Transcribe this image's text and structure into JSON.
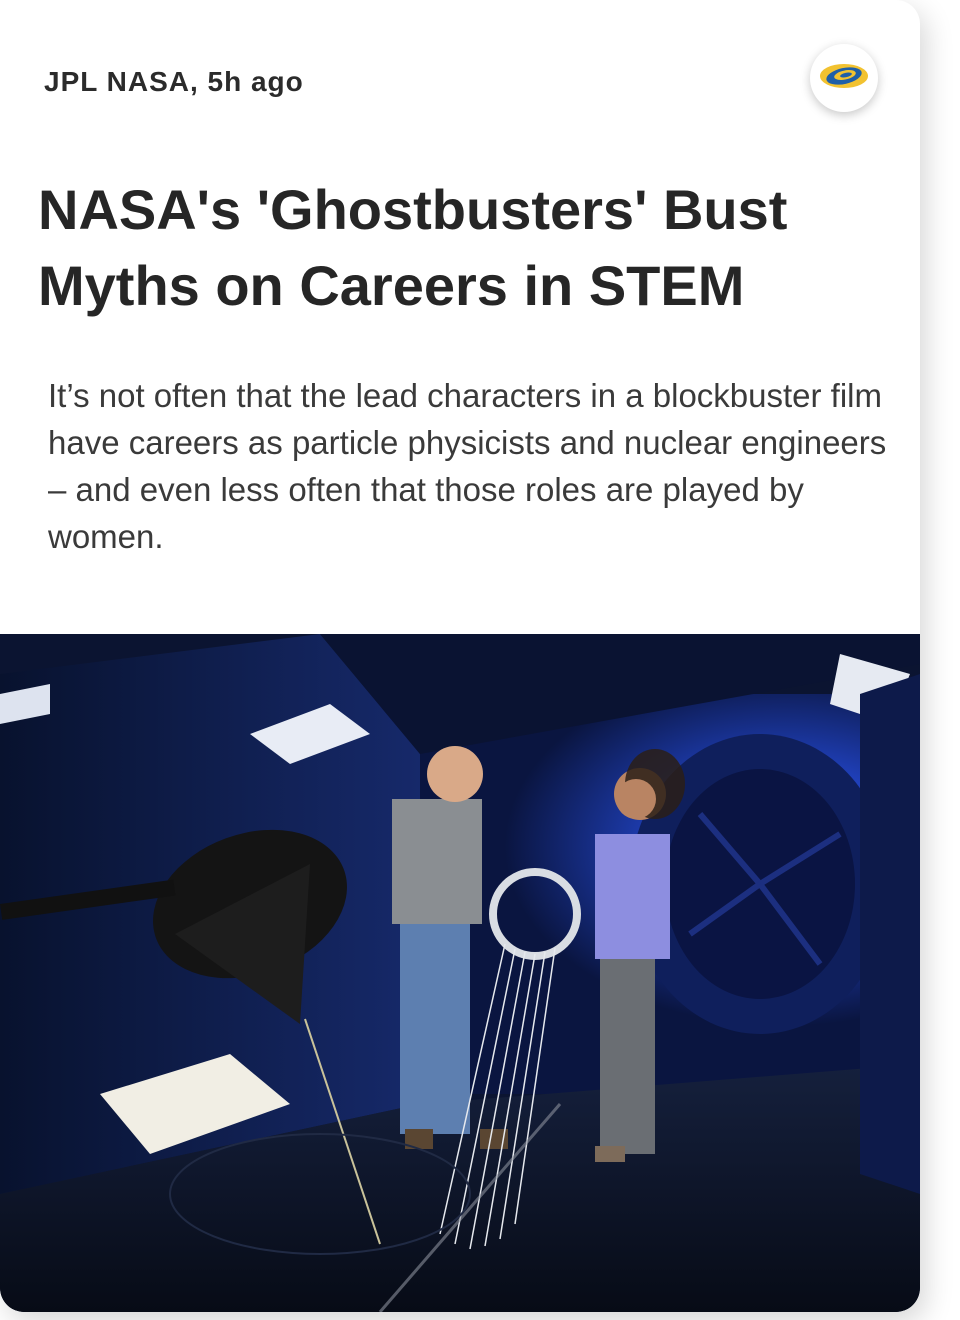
{
  "article": {
    "source": "JPL NASA",
    "age": "5h ago",
    "meta_line": "JPL NASA, 5h ago",
    "headline": "NASA's 'Ghostbusters' Bust Myths on Careers in STEM",
    "summary": "It’s not often that the lead characters in a blockbuster film have careers as particle physicists and nuclear engineers – and even less often that those roles are played by women."
  },
  "icons": {
    "source_logo": "jpl-logo-icon",
    "hero_image": "wind-tunnel-photo"
  },
  "colors": {
    "text_primary": "#262626",
    "text_body": "#3a3a3a",
    "logo_blue": "#1f5fa8",
    "logo_yellow": "#f2c230",
    "tunnel_blue": "#1a3fa0"
  }
}
